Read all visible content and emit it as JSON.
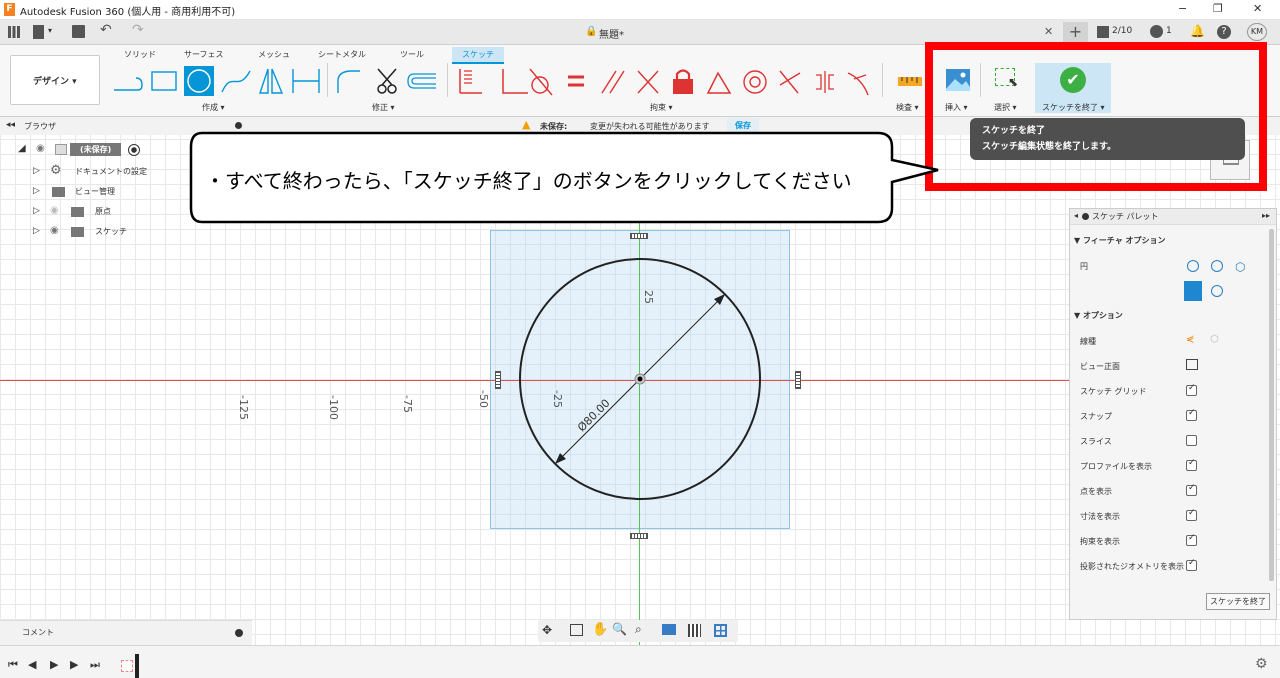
{
  "window": {
    "title": "Autodesk Fusion 360 (個人用 - 商用利用不可)",
    "min": "−",
    "max": "❐",
    "close": "✕"
  },
  "appbar": {
    "doc_title": "無題*",
    "jobs": "2/10",
    "notifications": "1",
    "user": "KM"
  },
  "ribbon": {
    "workspace": "デザイン ▾",
    "tabs": [
      "ソリッド",
      "サーフェス",
      "メッシュ",
      "シートメタル",
      "ツール",
      "スケッチ"
    ],
    "groups": {
      "create": "作成 ▾",
      "modify": "修正 ▾",
      "constraints": "拘束 ▾",
      "inspect": "検査 ▾",
      "insert": "挿入 ▾",
      "select": "選択 ▾",
      "finish": "スケッチを終了 ▾"
    }
  },
  "banner": {
    "status": "未保存:",
    "message": "変更が失われる可能性があります",
    "save": "保存"
  },
  "tooltip": {
    "title": "スケッチを終了",
    "desc": "スケッチ編集状態を終了します。"
  },
  "callout": {
    "text": "・すべて終わったら、「スケッチ終了」のボタンをクリックしてください"
  },
  "browser": {
    "header": "ブラウザ",
    "root": "(未保存)",
    "items": [
      "ドキュメントの設定",
      "ビュー管理",
      "原点",
      "スケッチ"
    ]
  },
  "comment": {
    "label": "コメント"
  },
  "canvas": {
    "ticks_h": [
      "-125",
      "-100",
      "-75",
      "-50",
      "-25"
    ],
    "tick_v": "25",
    "dimension": "Ø80.00"
  },
  "palette": {
    "title": "スケッチ パレット",
    "feature_options": "▼ フィーチャ オプション",
    "circle_label": "円",
    "options": "▼ オプション",
    "rows": [
      {
        "label": "線種",
        "type": "icon"
      },
      {
        "label": "ビュー正面",
        "type": "icon"
      },
      {
        "label": "スケッチ グリッド",
        "checked": true
      },
      {
        "label": "スナップ",
        "checked": true
      },
      {
        "label": "スライス",
        "checked": false
      },
      {
        "label": "プロファイルを表示",
        "checked": true
      },
      {
        "label": "点を表示",
        "checked": true
      },
      {
        "label": "寸法を表示",
        "checked": true
      },
      {
        "label": "拘束を表示",
        "checked": true
      },
      {
        "label": "投影されたジオメトリを表示",
        "checked": true
      }
    ],
    "finish_button": "スケッチを終了"
  },
  "colors": {
    "accent": "#0696d7",
    "highlight_box": "#ff0000",
    "callout_border": "#000000",
    "finish_green": "#3cb043",
    "axis_red": "#e05050",
    "axis_green": "#58c058"
  }
}
